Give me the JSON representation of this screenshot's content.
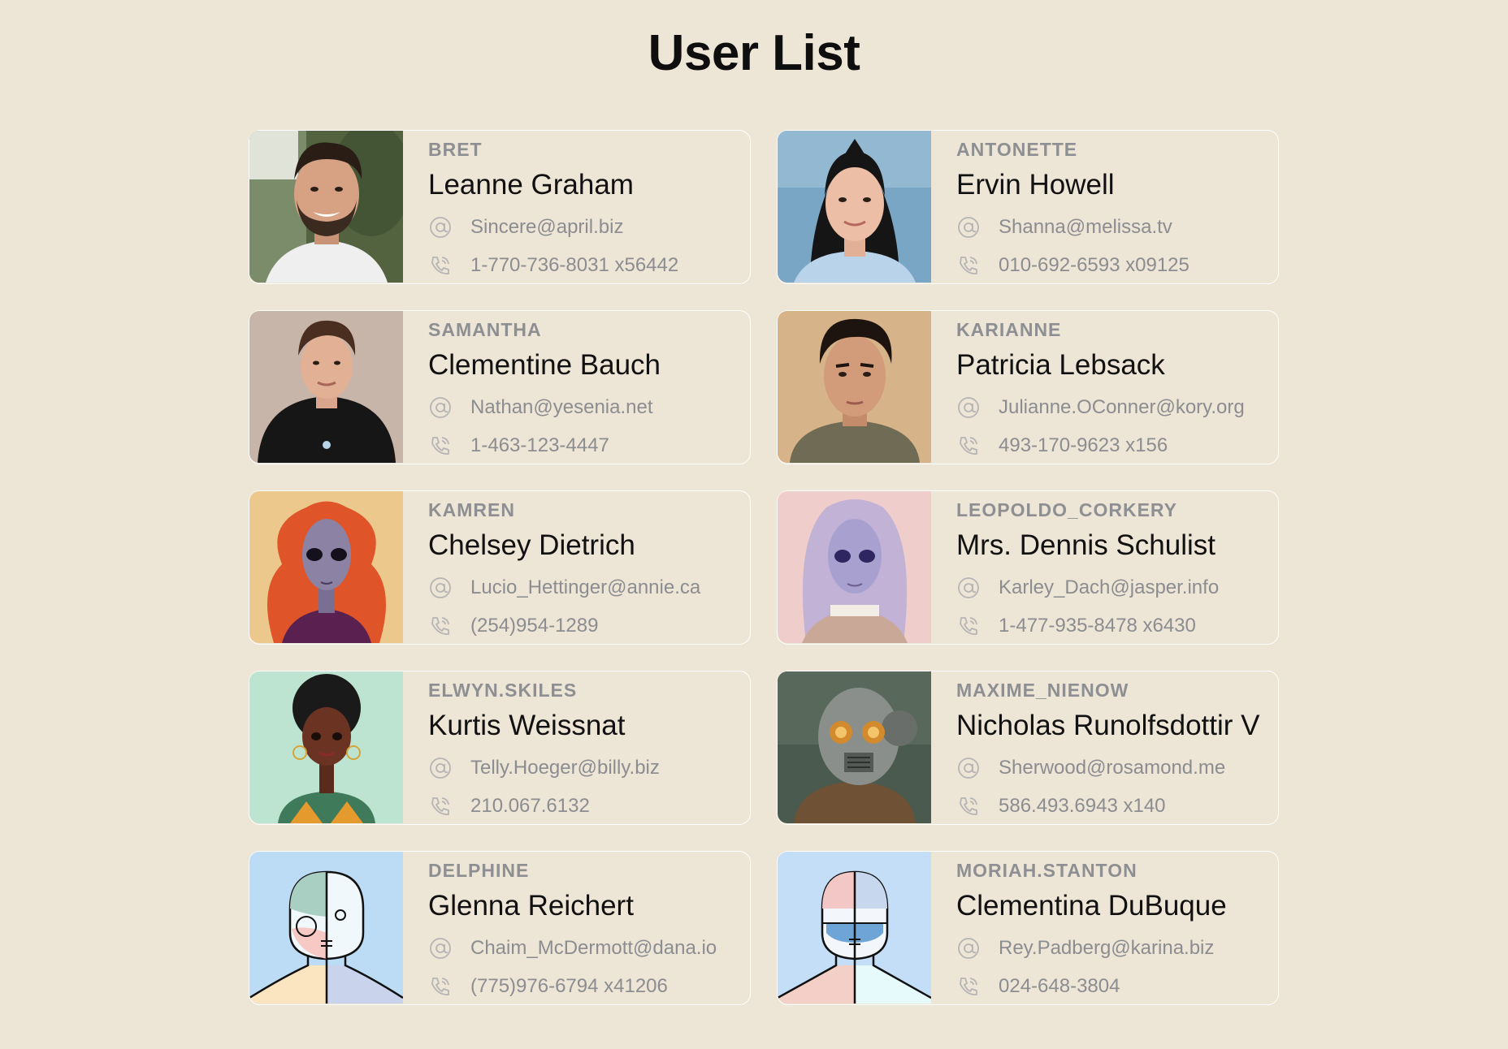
{
  "page": {
    "title": "User List",
    "background": "#ede5d6"
  },
  "users": [
    {
      "username": "BRET",
      "name": "Leanne Graham",
      "email": "Sincere@april.biz",
      "phone": "1-770-736-8031 x56442",
      "avatar": "photo-man-bearded",
      "avatar_bg": "#4f5e44"
    },
    {
      "username": "ANTONETTE",
      "name": "Ervin Howell",
      "email": "Shanna@melissa.tv",
      "phone": "010-692-6593 x09125",
      "avatar": "photo-woman-dark-hair",
      "avatar_bg": "#7aa3c4"
    },
    {
      "username": "SAMANTHA",
      "name": "Clementine Bauch",
      "email": "Nathan@yesenia.net",
      "phone": "1-463-123-4447",
      "avatar": "photo-man-hoodie",
      "avatar_bg": "#c9b6ab"
    },
    {
      "username": "KARIANNE",
      "name": "Patricia Lebsack",
      "email": "Julianne.OConner@kory.org",
      "phone": "493-170-9623 x156",
      "avatar": "photo-man-curly-hair",
      "avatar_bg": "#d9b98e"
    },
    {
      "username": "KAMREN",
      "name": "Chelsey Dietrich",
      "email": "Lucio_Hettinger@annie.ca",
      "phone": "(254)954-1289",
      "avatar": "alien-red-hair",
      "avatar_bg": "#ecc78b"
    },
    {
      "username": "LEOPOLDO_CORKERY",
      "name": "Mrs. Dennis Schulist",
      "email": "Karley_Dach@jasper.info",
      "phone": "1-477-935-8478 x6430",
      "avatar": "alien-lavender-braids",
      "avatar_bg": "#eccbc8"
    },
    {
      "username": "ELWYN.SKILES",
      "name": "Kurtis Weissnat",
      "email": "Telly.Hoeger@billy.biz",
      "phone": "210.067.6132",
      "avatar": "cartoon-woman-afro",
      "avatar_bg": "#b9e3cd"
    },
    {
      "username": "MAXIME_NIENOW",
      "name": "Nicholas Runolfsdottir V",
      "email": "Sherwood@rosamond.me",
      "phone": "586.493.6943 x140",
      "avatar": "steampunk-robot",
      "avatar_bg": "#4a5a4e"
    },
    {
      "username": "DELPHINE",
      "name": "Glenna Reichert",
      "email": "Chaim_McDermott@dana.io",
      "phone": "(775)976-6794 x41206",
      "avatar": "line-art-face-a",
      "avatar_bg": "#bcdcf5"
    },
    {
      "username": "MORIAH.STANTON",
      "name": "Clementina DuBuque",
      "email": "Rey.Padberg@karina.biz",
      "phone": "024-648-3804",
      "avatar": "line-art-face-b",
      "avatar_bg": "#c3def6"
    }
  ],
  "icons": {
    "email": "at-sign-icon",
    "phone": "phone-icon"
  }
}
